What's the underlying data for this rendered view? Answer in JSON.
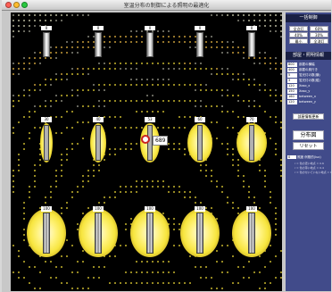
{
  "window": {
    "title": "室温分布の制御による照明の最適化",
    "traffic_lights": [
      "#ff5f56",
      "#ffbd2e",
      "#27c93f"
    ]
  },
  "canvas": {
    "hanging_lamps": [
      {
        "label": "0"
      },
      {
        "label": "0"
      },
      {
        "label": "0"
      },
      {
        "label": "0"
      },
      {
        "label": "0"
      }
    ],
    "middle_lamps": [
      {
        "label": "30"
      },
      {
        "label": "40"
      },
      {
        "label": "53"
      },
      {
        "label": "60"
      },
      {
        "label": "70"
      }
    ],
    "bottom_lamps": [
      {
        "label": "100"
      },
      {
        "label": "100"
      },
      {
        "label": "100"
      },
      {
        "label": "100"
      },
      {
        "label": "100"
      }
    ],
    "sensor_value": "689"
  },
  "panel": {
    "control_header": "一括制御",
    "control_buttons": [
      "全点灯",
      "60%",
      "40%",
      "30%",
      "最小",
      "全消灯"
    ],
    "params_header": "部屋・照明情報",
    "params": [
      {
        "value": "800",
        "label": "部屋の横幅"
      },
      {
        "value": "400",
        "label": "部屋の奥行き"
      },
      {
        "value": "5",
        "label": "蛍光灯の数(横)"
      },
      {
        "value": "3",
        "label": "蛍光灯の数(縦)"
      },
      {
        "value": "120",
        "label": "Xoso_x"
      },
      {
        "value": "150",
        "label": "Xoso_y"
      },
      {
        "value": "160",
        "label": "between_x"
      },
      {
        "value": "120",
        "label": "between_y"
      }
    ],
    "update_button": "部屋情報更新",
    "distribution_button": "分布図",
    "reset_button": "リセット",
    "status_value": "0",
    "status_label": "照度 例照的(lux)",
    "notes": [
      "r = 色の濃い地点 = 0.6",
      "r = 色の薄い地点 = 0.4",
      "r = 色の付いていない地点 = 0"
    ]
  }
}
